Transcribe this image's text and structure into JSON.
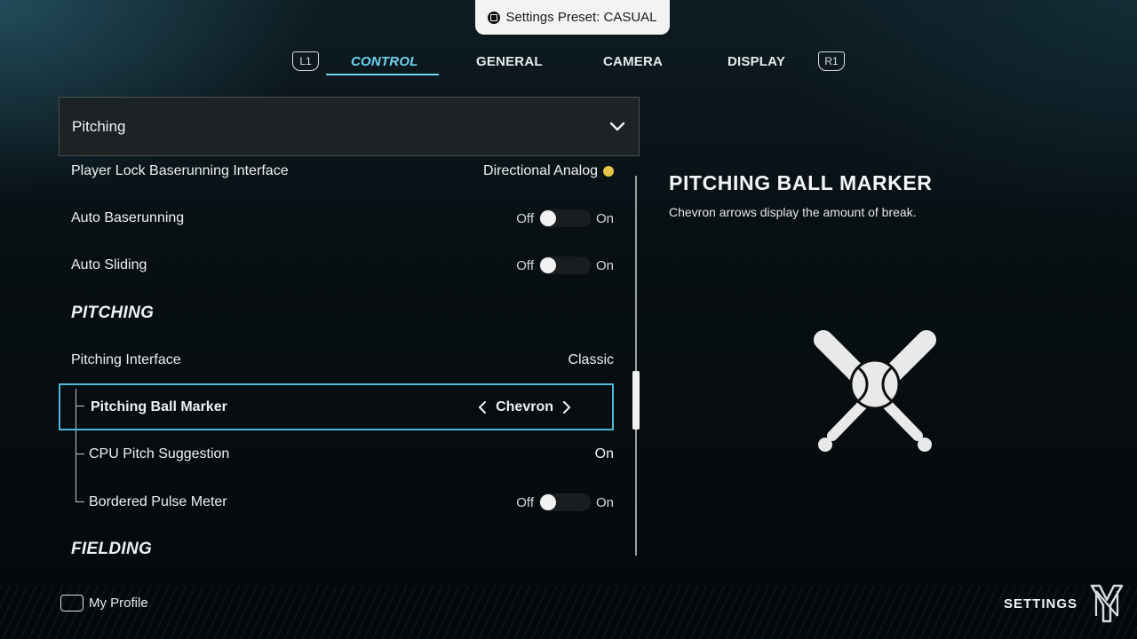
{
  "preset": {
    "label": "Settings Preset: CASUAL",
    "button_icon": "square-button-icon"
  },
  "tabs": {
    "left_bumper": "L1",
    "right_bumper": "R1",
    "items": [
      {
        "label": "CONTROL",
        "active": true
      },
      {
        "label": "GENERAL",
        "active": false
      },
      {
        "label": "CAMERA",
        "active": false
      },
      {
        "label": "DISPLAY",
        "active": false
      }
    ]
  },
  "dropdown": {
    "value": "Pitching"
  },
  "settings": {
    "partial_row": {
      "label": "Player Lock Baserunning Interface",
      "value": "Directional Analog"
    },
    "auto_baserunning": {
      "label": "Auto Baserunning",
      "off": "Off",
      "on": "On"
    },
    "auto_sliding": {
      "label": "Auto Sliding",
      "off": "Off",
      "on": "On"
    },
    "section_pitching": "PITCHING",
    "pitching_interface": {
      "label": "Pitching Interface",
      "value": "Classic"
    },
    "pitching_ball_marker": {
      "label": "Pitching Ball Marker",
      "value": "Chevron"
    },
    "cpu_pitch_suggestion": {
      "label": "CPU Pitch Suggestion",
      "value": "On"
    },
    "bordered_pulse_meter": {
      "label": "Bordered Pulse Meter",
      "off": "Off",
      "on": "On"
    },
    "section_fielding": "FIELDING"
  },
  "detail": {
    "title": "PITCHING BALL MARKER",
    "description": "Chevron arrows display the amount of break."
  },
  "footer": {
    "profile_label": "My Profile",
    "screen_title": "SETTINGS"
  },
  "colors": {
    "accent": "#6fd3f0",
    "selection_border": "#4fb8d6"
  }
}
